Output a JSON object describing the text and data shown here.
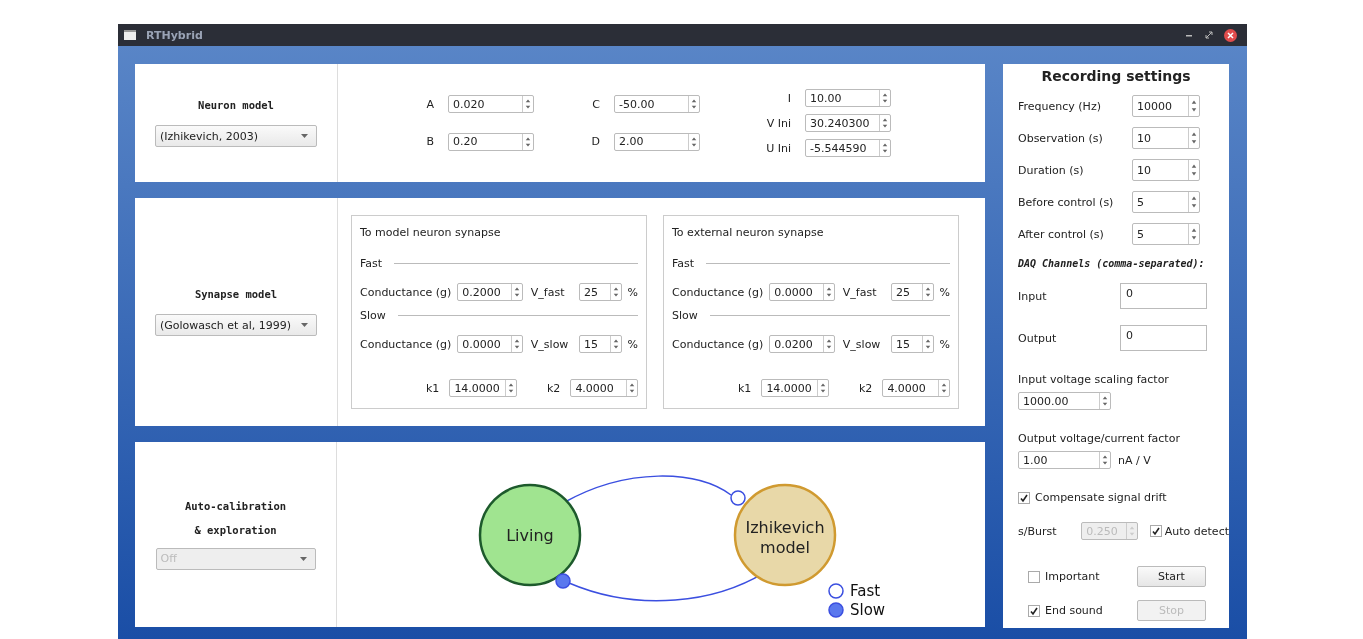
{
  "window": {
    "title": "RTHybrid"
  },
  "neuron_model": {
    "label": "Neuron model",
    "dropdown": "(Izhikevich, 2003)",
    "param_columns": [
      [
        {
          "label": "A",
          "value": "0.020"
        },
        {
          "label": "B",
          "value": "0.20"
        }
      ],
      [
        {
          "label": "C",
          "value": "-50.00"
        },
        {
          "label": "D",
          "value": "2.00"
        }
      ],
      [
        {
          "label": "I",
          "value": "10.00"
        },
        {
          "label": "V Ini",
          "value": "30.240300"
        },
        {
          "label": "U Ini",
          "value": "-5.544590"
        }
      ]
    ]
  },
  "synapse_model": {
    "label": "Synapse model",
    "dropdown": "(Golowasch et al, 1999)",
    "synapses": [
      {
        "title": "To model neuron synapse",
        "sections": [
          {
            "heading": "Fast",
            "conductance_label": "Conductance (g)",
            "conductance": "0.2000",
            "v_label": "V_fast",
            "v": "25",
            "unit": "%"
          },
          {
            "heading": "Slow",
            "conductance_label": "Conductance (g)",
            "conductance": "0.0000",
            "v_label": "V_slow",
            "v": "15",
            "unit": "%"
          }
        ],
        "k": [
          {
            "label": "k1",
            "value": "14.0000"
          },
          {
            "label": "k2",
            "value": "4.0000"
          }
        ]
      },
      {
        "title": "To external neuron synapse",
        "sections": [
          {
            "heading": "Fast",
            "conductance_label": "Conductance (g)",
            "conductance": "0.0000",
            "v_label": "V_fast",
            "v": "25",
            "unit": "%"
          },
          {
            "heading": "Slow",
            "conductance_label": "Conductance (g)",
            "conductance": "0.0200",
            "v_label": "V_slow",
            "v": "15",
            "unit": "%"
          }
        ],
        "k": [
          {
            "label": "k1",
            "value": "14.0000"
          },
          {
            "label": "k2",
            "value": "4.0000"
          }
        ]
      }
    ]
  },
  "auto_calibration": {
    "label_lines": [
      "Auto-calibration",
      "& exploration"
    ],
    "dropdown": "Off",
    "disabled": true
  },
  "diagram": {
    "nodes": [
      {
        "label": "Living",
        "color": "#a0e490"
      },
      {
        "label": "Izhikevich model",
        "color": "#e8d8a8"
      }
    ],
    "legend": [
      {
        "label": "Fast",
        "kind": "open"
      },
      {
        "label": "Slow",
        "kind": "filled"
      }
    ]
  },
  "recording": {
    "title": "Recording settings",
    "fields": [
      {
        "label": "Frequency (Hz)",
        "value": "10000"
      },
      {
        "label": "Observation (s)",
        "value": "10"
      },
      {
        "label": "Duration (s)",
        "value": "10"
      },
      {
        "label": "Before control (s)",
        "value": "5"
      },
      {
        "label": "After control (s)",
        "value": "5"
      }
    ],
    "daq_heading": "DAQ Channels (comma-separated):",
    "channels": [
      {
        "label": "Input",
        "value": "0"
      },
      {
        "label": "Output",
        "value": "0"
      }
    ],
    "input_scaling": {
      "label": "Input voltage scaling factor",
      "value": "1000.00"
    },
    "output_factor": {
      "label": "Output voltage/current factor",
      "value": "1.00",
      "unit": "nA / V"
    },
    "compensate": {
      "label": "Compensate signal drift",
      "checked": true
    },
    "burst": {
      "label": "s/Burst",
      "value": "0.250",
      "disabled": true
    },
    "auto_detect": {
      "label": "Auto detect",
      "checked": true
    },
    "important": {
      "label": "Important",
      "checked": false
    },
    "end_sound": {
      "label": "End sound",
      "checked": true
    },
    "buttons": [
      {
        "label": "Start",
        "disabled": false
      },
      {
        "label": "Stop",
        "disabled": true
      }
    ]
  }
}
